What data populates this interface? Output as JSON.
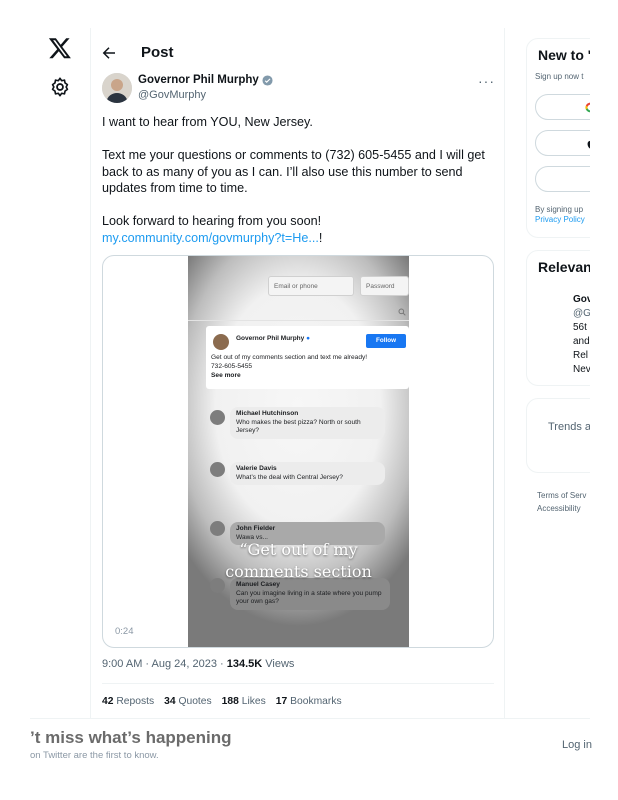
{
  "header": {
    "title": "Post"
  },
  "author": {
    "name": "Governor Phil Murphy",
    "handle": "@GovMurphy"
  },
  "post": {
    "paragraph1": "I want to hear from YOU, New Jersey.",
    "paragraph2": "Text me your questions or comments to (732) 605-5455 and I will get back to as many of you as I can. I’ll also use this number to send updates from time to time.",
    "paragraph3": "Look forward to hearing from you soon!",
    "link": "my.community.com/govmurphy?t=He...",
    "link_suffix": "!",
    "timestamp": "9:00 AM · Aug 24, 2023 · ",
    "views_count": "134.5K",
    "views_label": " Views"
  },
  "video": {
    "duration": "0:24",
    "email_placeholder": "Email or phone",
    "password_placeholder": "Password",
    "fb_name": "Governor Phil Murphy",
    "fb_follow": "Follow",
    "fb_text_line1": "Get out of my comments section and text me already!",
    "fb_text_line2": "732-605-5455",
    "fb_see_more": "See more",
    "comments": [
      {
        "name": "Michael Hutchinson",
        "text": "Who makes the best pizza?  North or south Jersey?"
      },
      {
        "name": "Valerie Davis",
        "text": "What’s the deal with Central Jersey?"
      },
      {
        "name": "John Fielder",
        "text": "Wawa vs..."
      },
      {
        "name": "Manuel Casey",
        "text": "Can you imagine living in a state where you pump your own gas?"
      }
    ],
    "caption_line1": "“Get out of my",
    "caption_line2": "comments section"
  },
  "stats": {
    "reposts_count": "42",
    "reposts_label": "Reposts",
    "quotes_count": "34",
    "quotes_label": "Quotes",
    "likes_count": "188",
    "likes_label": "Likes",
    "bookmarks_count": "17",
    "bookmarks_label": "Bookmarks"
  },
  "sidebar": {
    "new_title": "New to '",
    "new_sub": "Sign up now t",
    "legal_line1": "By signing up",
    "legal_line2": "Privacy Policy",
    "relevant_title": "Relevan",
    "relevant_name": "Gov",
    "relevant_lines": [
      "@G",
      "56t",
      "and",
      "Rel",
      "Nev"
    ],
    "trends_text": "Trends a",
    "footer_line1": "Terms of Serv",
    "footer_line2": "Accessibility"
  },
  "banner": {
    "title": "’t miss what’s happening",
    "subtitle": " on Twitter are the first to know.",
    "login": "Log in"
  },
  "colors": {
    "accent": "#1d9bf0",
    "text": "#0f1419",
    "muted": "#536471",
    "fb_blue": "#1877f2"
  }
}
